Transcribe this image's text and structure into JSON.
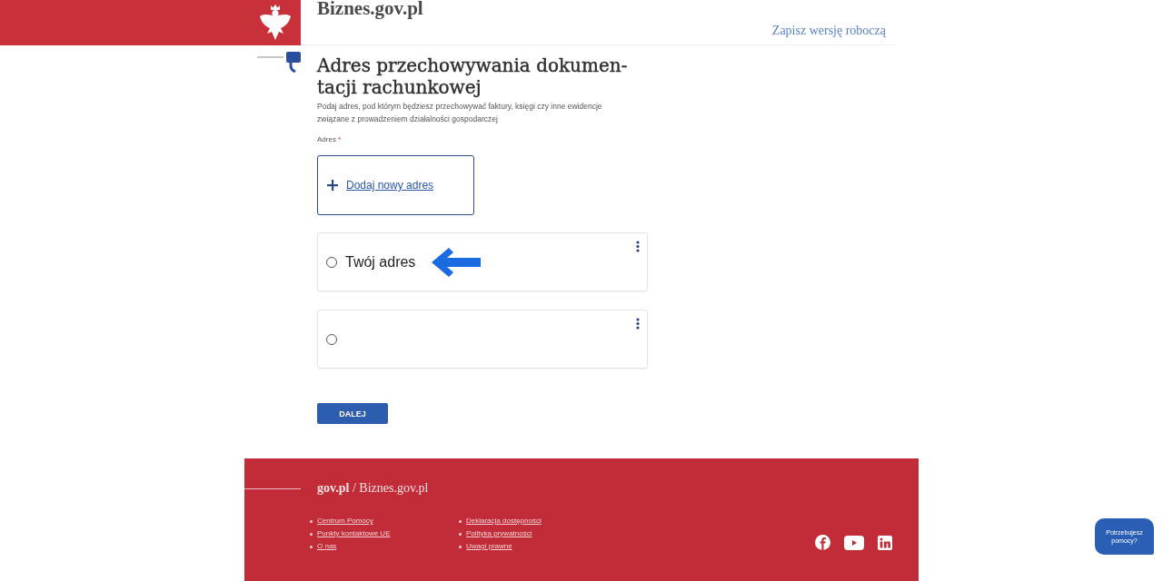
{
  "header": {
    "site_title": "Biznes.gov.pl",
    "save_draft_link": "Zapisz wersję roboczą"
  },
  "form": {
    "title": "Adres przechowywania dokumen-tacji rachunkowej",
    "description": "Podaj adres, pod którym będziesz przechowywać faktury, księgi czy inne ewidencje związane z prowadzeniem działalności gospodarczej",
    "field_label": "Adres",
    "required_mark": "*",
    "add_address_link": "Dodaj nowy adres",
    "options": [
      {
        "label": "Twój adres",
        "selected": false,
        "arrow_marker": true
      },
      {
        "selected": false,
        "arrow_marker": false
      }
    ],
    "next_button": "DALEJ"
  },
  "footer": {
    "brand": "**gov.pl** / Biznes.gov.pl",
    "link_columns": [
      [
        "Centrum Pomocy",
        "Punkty kontaktowe UE",
        "O nas"
      ],
      [
        "Deklaracja dostępności",
        "Polityka prywatności",
        "Uwagi prawne"
      ]
    ]
  },
  "help_bubble": "Potrzebujesz pomocy?"
}
